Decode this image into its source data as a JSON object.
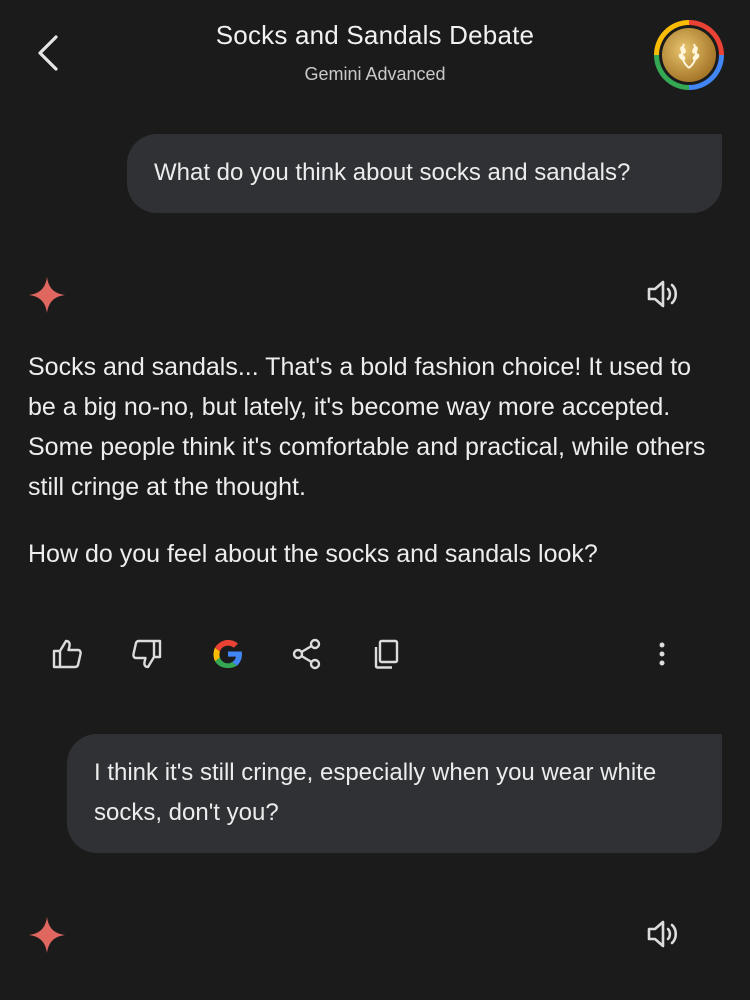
{
  "header": {
    "title": "Socks and Sandals Debate",
    "subtitle": "Gemini Advanced"
  },
  "messages": {
    "user1": "What do you think about socks and sandals?",
    "reply1_p1": "Socks and sandals... That's a bold fashion choice! It used to be a big no-no, but lately, it's become way more accepted. Some people think it's comfortable and practical, while others still cringe at the thought.",
    "reply1_p2": "How do you feel about the socks and sandals look?",
    "user2": "I think it's still cringe, especially when you wear white socks, don't you?"
  },
  "icons": {
    "back": "back-arrow-icon",
    "gemini": "gemini-sparkle-icon",
    "speaker": "speaker-icon",
    "thumbs_up": "thumbs-up-icon",
    "thumbs_down": "thumbs-down-icon",
    "google": "google-g-icon",
    "share": "share-icon",
    "copy": "copy-icon",
    "more": "more-vert-icon"
  },
  "colors": {
    "background": "#1b1b1c",
    "bubble": "#2f3134",
    "sparkle": "#e0675f"
  }
}
